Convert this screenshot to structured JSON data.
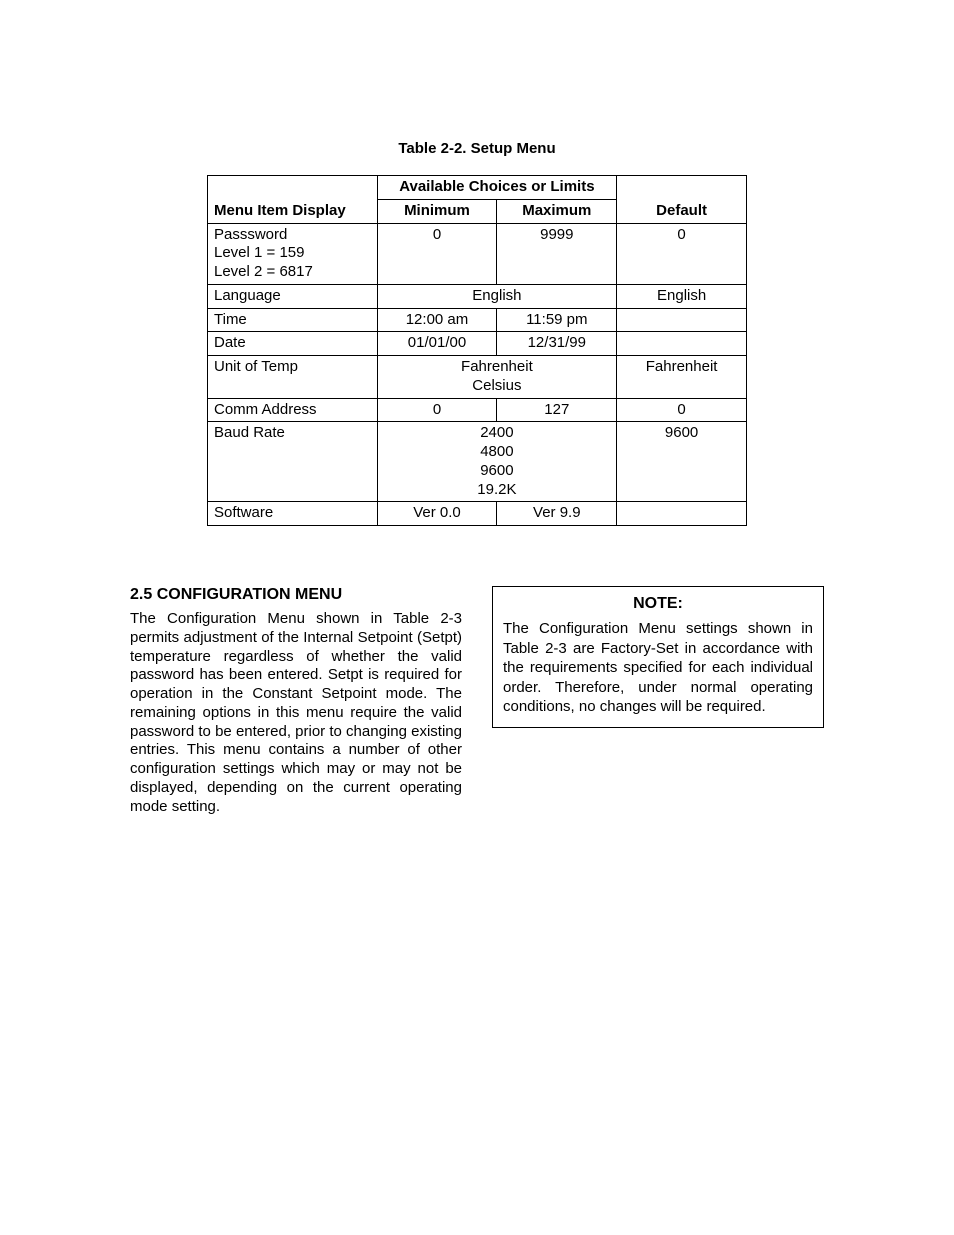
{
  "table": {
    "caption": "Table 2-2.  Setup Menu",
    "headers": {
      "menuItem": "Menu Item Display",
      "choices": "Available Choices or Limits",
      "minimum": "Minimum",
      "maximum": "Maximum",
      "default": "Default"
    },
    "rows": {
      "password": {
        "item": "Passsword\nLevel 1 = 159\nLevel 2 = 6817",
        "min": "0",
        "max": "9999",
        "def": "0"
      },
      "language": {
        "item": "Language",
        "choices": "English",
        "def": "English"
      },
      "time": {
        "item": "Time",
        "min": "12:00 am",
        "max": "11:59 pm",
        "def": ""
      },
      "date": {
        "item": "Date",
        "min": "01/01/00",
        "max": "12/31/99",
        "def": ""
      },
      "unitTemp": {
        "item": "Unit of Temp",
        "choices": "Fahrenheit\nCelsius",
        "def": "Fahrenheit"
      },
      "commAddr": {
        "item": "Comm Address",
        "min": "0",
        "max": "127",
        "def": "0"
      },
      "baud": {
        "item": "Baud Rate",
        "choices": "2400\n4800\n9600\n19.2K\n ",
        "def": "9600"
      },
      "software": {
        "item": "Software",
        "min": "Ver 0.0",
        "max": "Ver 9.9",
        "def": ""
      }
    }
  },
  "section": {
    "heading": "2.5   CONFIGURATION MENU",
    "body": "The Configuration Menu shown in Table 2-3 permits adjustment of the Internal Setpoint (Setpt) temperature regardless of whether the valid password has been entered.  Setpt is required for operation in the Constant Setpoint mode.  The remaining options in this menu require the valid password to be entered, prior to changing existing entries.  This menu contains a number of other configuration settings which may or may not be displayed, depending on the current operating mode setting."
  },
  "note": {
    "title": "NOTE:",
    "body": "The Configuration Menu settings shown in Table 2-3 are Factory-Set in accordance with the requirements specified for each individual order. Therefore, under normal operating conditions, no changes will be required."
  }
}
